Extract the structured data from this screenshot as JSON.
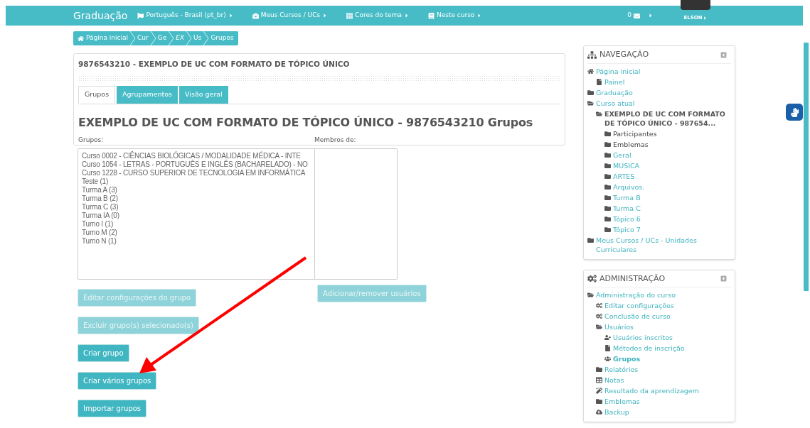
{
  "topbar": {
    "brand": "Graduação",
    "menus": [
      {
        "kind": "flag",
        "label": "Português - Brasil (pt_br)"
      },
      {
        "kind": "briefcase",
        "label": "Meus Cursos / UCs"
      },
      {
        "kind": "grid",
        "label": "Cores do tema"
      },
      {
        "kind": "book",
        "label": "Neste curso"
      }
    ],
    "messages": "0",
    "user": "ELSON"
  },
  "breadcrumb": [
    {
      "label": "Página inicial",
      "kind": "home"
    },
    {
      "label": "Cur",
      "kind": "plain"
    },
    {
      "label": "Ge",
      "kind": "plain"
    },
    {
      "label": "EX",
      "kind": "italic"
    },
    {
      "label": "Us",
      "kind": "plain"
    },
    {
      "label": "Grupos",
      "kind": "plain"
    }
  ],
  "course_title": "9876543210 - EXEMPLO DE UC COM FORMATO DE TÓPICO ÚNICO",
  "tabs": [
    {
      "label": "Grupos",
      "selected": true
    },
    {
      "label": "Agrupamentos",
      "selected": false
    },
    {
      "label": "Visão geral",
      "selected": false
    }
  ],
  "heading": "EXEMPLO DE UC COM FORMATO DE TÓPICO ÚNICO - 9876543210 Grupos",
  "groups_label": "Grupos:",
  "members_label": "Membros de:",
  "groups": [
    "Curso 0002 - CIÊNCIAS BIOLÓGICAS / MODALIDADE MÉDICA - INTE",
    "Curso 1054 - LETRAS - PORTUGUÊS E INGLÊS (BACHARELADO) - NO",
    "Curso 1228 - CURSO SUPERIOR DE TECNOLOGIA EM INFORMÁTICA",
    "Teste (1)",
    "Turma A (3)",
    "Turma B (2)",
    "Turma C (3)",
    "Turma IA (0)",
    "Turno I (1)",
    "Turno M (2)",
    "Turno N (1)"
  ],
  "members_button": {
    "label": "Adicionar/remover usuários",
    "disabled": true
  },
  "buttons": [
    {
      "label": "Editar configurações do grupo",
      "disabled": true
    },
    {
      "label": "Excluir grupo(s) selecionado(s)",
      "disabled": true
    },
    {
      "label": "Criar grupo",
      "disabled": false
    },
    {
      "label": "Criar vários grupos",
      "disabled": false
    },
    {
      "label": "Importar grupos",
      "disabled": false
    }
  ],
  "navigation": {
    "title": "NAVEGAÇÃO",
    "items": [
      {
        "label": "Página inicial",
        "kind": "home",
        "link": true,
        "selected": false,
        "children": [
          {
            "label": "Painel",
            "kind": "file",
            "link": true,
            "selected": false
          }
        ]
      },
      {
        "label": "Graduação",
        "kind": "folder",
        "link": true,
        "selected": false
      },
      {
        "label": "Curso atual",
        "kind": "folder-open",
        "link": true,
        "selected": false,
        "children": [
          {
            "label": "EXEMPLO DE UC COM FORMATO DE TÓPICO ÚNICO - 987654...",
            "kind": "folder-open",
            "link": false,
            "selected": true,
            "children": [
              {
                "label": "Participantes",
                "kind": "folder",
                "link": false,
                "selected": false
              },
              {
                "label": "Emblemas",
                "kind": "folder",
                "link": false,
                "selected": false
              },
              {
                "label": "Geral",
                "kind": "folder",
                "link": true,
                "selected": false
              },
              {
                "label": "MÚSICA",
                "kind": "folder",
                "link": true,
                "selected": false
              },
              {
                "label": "ARTES",
                "kind": "folder",
                "link": true,
                "selected": false
              },
              {
                "label": "Arquivos.",
                "kind": "folder",
                "link": true,
                "selected": false
              },
              {
                "label": "Turma B",
                "kind": "folder",
                "link": true,
                "selected": false
              },
              {
                "label": "Turma C",
                "kind": "folder",
                "link": true,
                "selected": false
              },
              {
                "label": "Tópico 6",
                "kind": "folder",
                "link": true,
                "selected": false
              },
              {
                "label": "Tópico 7",
                "kind": "folder",
                "link": true,
                "selected": false
              }
            ]
          }
        ]
      },
      {
        "label": "Meus Cursos / UCs - Unidades Curriculares",
        "kind": "folder",
        "link": true,
        "selected": false
      }
    ]
  },
  "administration": {
    "title": "ADMINISTRAÇÃO",
    "items": [
      {
        "label": "Administração do curso",
        "kind": "folder-open",
        "link": true,
        "selected": false,
        "children": [
          {
            "label": "Editar configurações",
            "kind": "gears",
            "link": true,
            "selected": false
          },
          {
            "label": "Conclusão de curso",
            "kind": "gears",
            "link": true,
            "selected": false
          },
          {
            "label": "Usuários",
            "kind": "folder-open",
            "link": true,
            "selected": false,
            "children": [
              {
                "label": "Usuários inscritos",
                "kind": "user-plus",
                "link": true,
                "selected": false
              },
              {
                "label": "Métodos de inscrição",
                "kind": "file",
                "link": true,
                "selected": false
              },
              {
                "label": "Grupos",
                "kind": "users",
                "link": true,
                "selected": true
              }
            ]
          },
          {
            "label": "Relatórios",
            "kind": "folder",
            "link": true,
            "selected": false
          },
          {
            "label": "Notas",
            "kind": "table",
            "link": true,
            "selected": false
          },
          {
            "label": "Resultado da aprendizagem",
            "kind": "wand",
            "link": true,
            "selected": false
          },
          {
            "label": "Emblemas",
            "kind": "folder",
            "link": true,
            "selected": false
          },
          {
            "label": "Backup",
            "kind": "cloud",
            "link": true,
            "selected": false
          }
        ]
      }
    ]
  }
}
